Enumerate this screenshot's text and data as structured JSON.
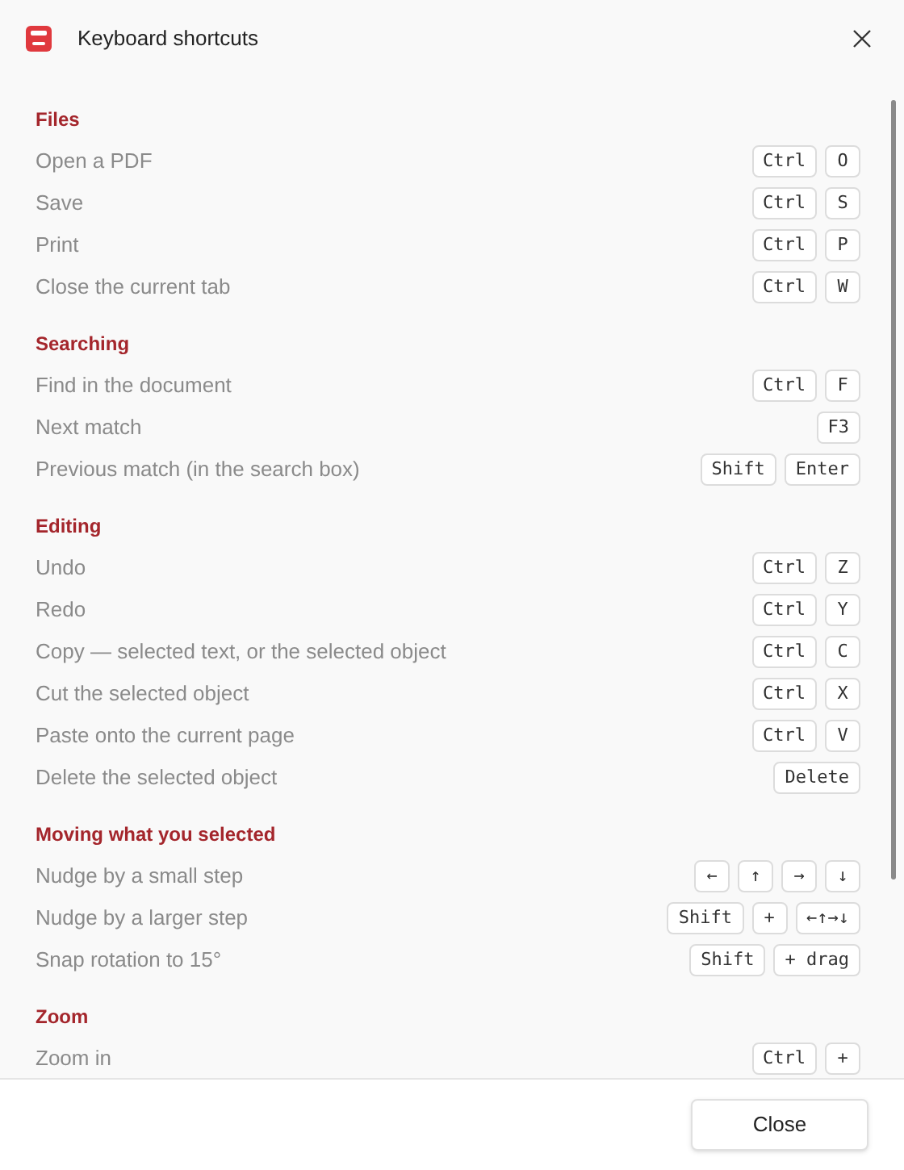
{
  "dialog": {
    "title": "Keyboard shortcuts"
  },
  "sections": [
    {
      "heading": "Files",
      "rows": [
        {
          "action": "Open a PDF",
          "keys": [
            "Ctrl",
            "O"
          ]
        },
        {
          "action": "Save",
          "keys": [
            "Ctrl",
            "S"
          ]
        },
        {
          "action": "Print",
          "keys": [
            "Ctrl",
            "P"
          ]
        },
        {
          "action": "Close the current tab",
          "keys": [
            "Ctrl",
            "W"
          ]
        }
      ]
    },
    {
      "heading": "Searching",
      "rows": [
        {
          "action": "Find in the document",
          "keys": [
            "Ctrl",
            "F"
          ]
        },
        {
          "action": "Next match",
          "keys": [
            "F3"
          ]
        },
        {
          "action": "Previous match (in the search box)",
          "keys": [
            "Shift",
            "Enter"
          ]
        }
      ]
    },
    {
      "heading": "Editing",
      "rows": [
        {
          "action": "Undo",
          "keys": [
            "Ctrl",
            "Z"
          ]
        },
        {
          "action": "Redo",
          "keys": [
            "Ctrl",
            "Y"
          ]
        },
        {
          "action": "Copy — selected text, or the selected object",
          "keys": [
            "Ctrl",
            "C"
          ]
        },
        {
          "action": "Cut the selected object",
          "keys": [
            "Ctrl",
            "X"
          ]
        },
        {
          "action": "Paste onto the current page",
          "keys": [
            "Ctrl",
            "V"
          ]
        },
        {
          "action": "Delete the selected object",
          "keys": [
            "Delete"
          ]
        }
      ]
    },
    {
      "heading": "Moving what you selected",
      "rows": [
        {
          "action": "Nudge by a small step",
          "keys": [
            "←",
            "↑",
            "→",
            "↓"
          ]
        },
        {
          "action": "Nudge by a larger step",
          "keys": [
            "Shift",
            "+",
            "←↑→↓"
          ]
        },
        {
          "action": "Snap rotation to 15°",
          "keys": [
            "Shift",
            "+ drag"
          ]
        }
      ]
    },
    {
      "heading": "Zoom",
      "rows": [
        {
          "action": "Zoom in",
          "keys": [
            "Ctrl",
            "+"
          ]
        }
      ]
    }
  ],
  "footer": {
    "button": "Close"
  }
}
